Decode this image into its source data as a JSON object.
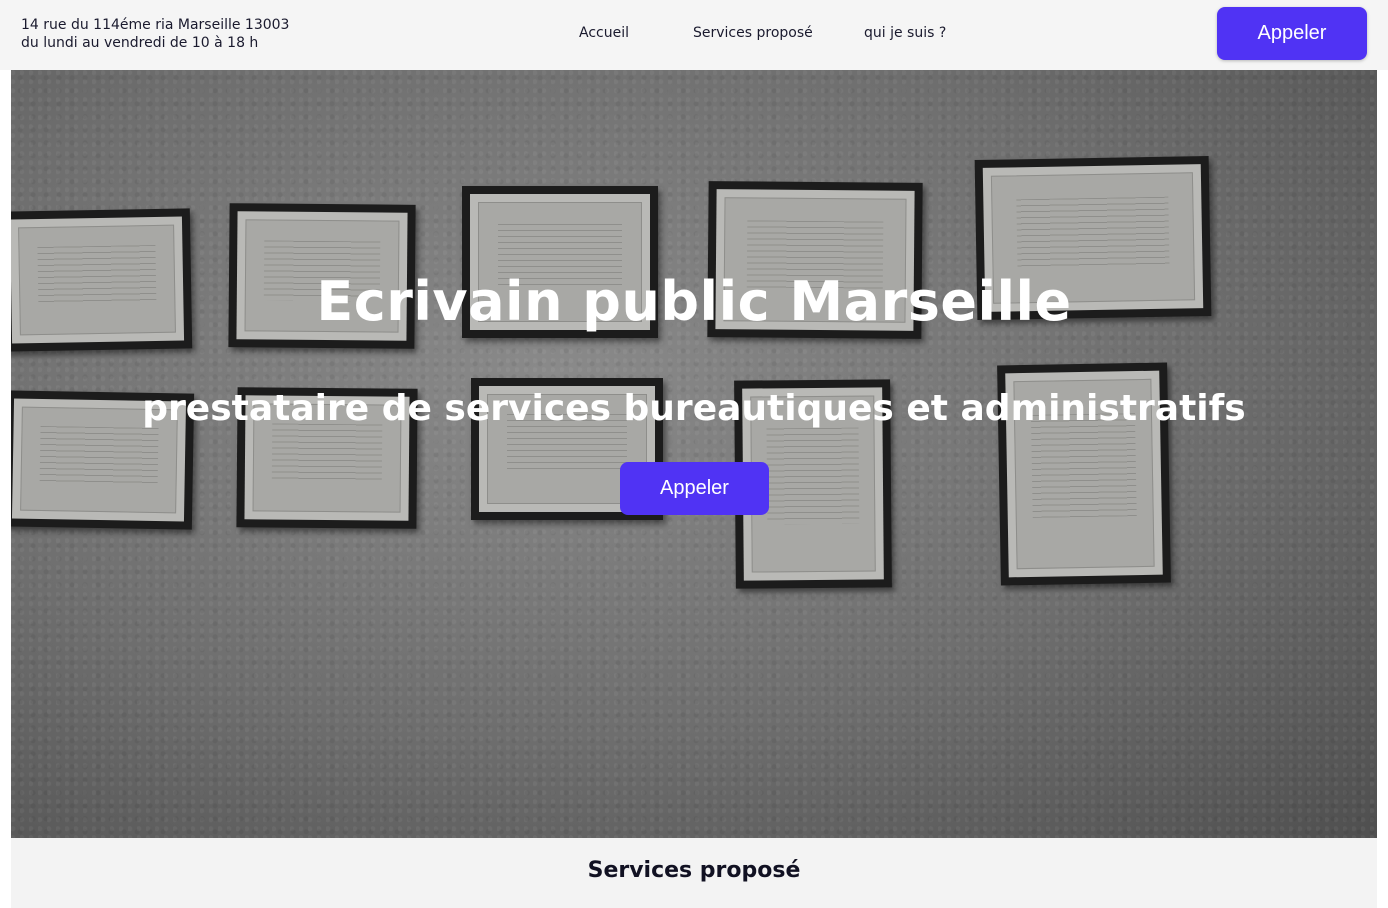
{
  "header": {
    "address_line1": "14 rue du 114éme ria Marseille 13003",
    "address_line2": "du lundi au vendredi de 10 à 18 h",
    "nav": {
      "home": "Accueil",
      "services": "Services proposé",
      "about": "qui je suis ?"
    },
    "call_button": "Appeler"
  },
  "hero": {
    "title": "Ecrivain public Marseille",
    "subtitle": "prestataire de services bureautiques et administratifs",
    "call_button": "Appeler"
  },
  "services_section": {
    "heading": "Services proposé"
  },
  "colors": {
    "accent": "#5033f4",
    "header_bg": "#f5f5f5",
    "text_dark": "#1a1a2e"
  }
}
